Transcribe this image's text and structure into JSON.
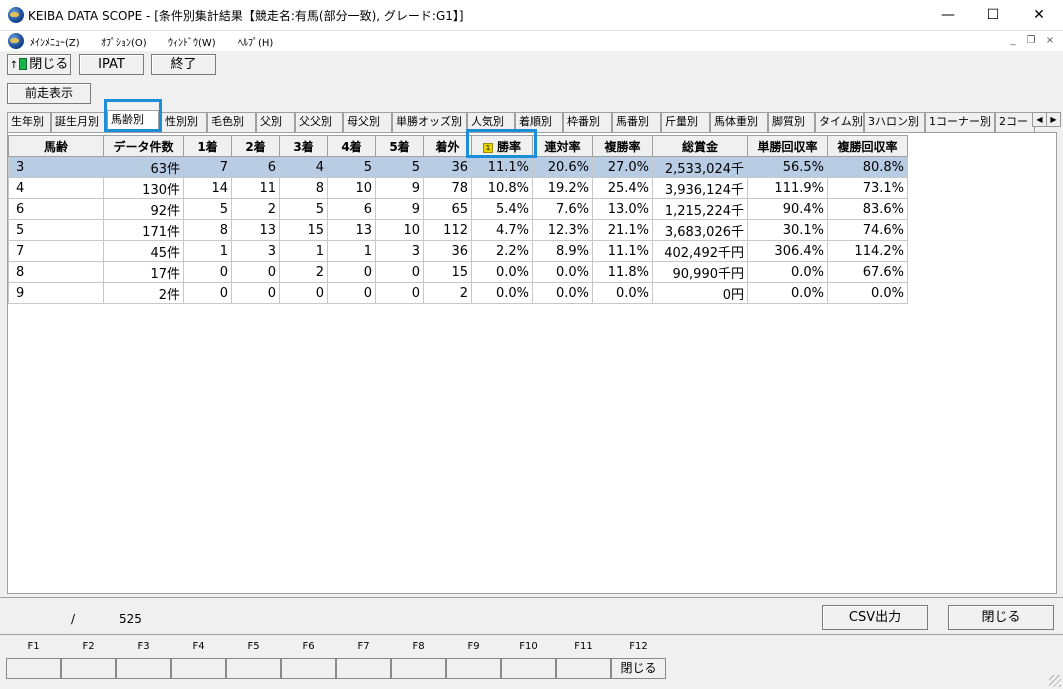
{
  "window": {
    "title": "KEIBA DATA SCOPE - [条件別集計結果【競走名:有馬(部分一致), グレード:G1】]",
    "minimize_glyph": "—",
    "maximize_glyph": "☐",
    "close_glyph": "✕",
    "icon": "app-globe-icon"
  },
  "menubar": {
    "items": [
      "ﾒｲﾝﾒﾆｭｰ(Z)",
      "ｵﾌﾟｼｮﾝ(O)",
      "ｳｨﾝﾄﾞｳ(W)",
      "ﾍﾙﾌﾟ(H)"
    ],
    "mdi_minimize": "_",
    "mdi_restore": "❐",
    "mdi_close": "×"
  },
  "toolbar": {
    "close_label": "閉じる",
    "ipat_label": "IPAT",
    "exit_label": "終了",
    "prev_run_label": "前走表示"
  },
  "tabs": {
    "items": [
      "生年別",
      "誕生月別",
      "馬齢別",
      "性別別",
      "毛色別",
      "父別",
      "父父別",
      "母父別",
      "単勝オッズ別",
      "人気別",
      "着順別",
      "枠番別",
      "馬番別",
      "斤量別",
      "馬体重別",
      "脚質別",
      "タイム別",
      "3ハロン別",
      "1コーナー別",
      "2コー"
    ],
    "active": "馬齢別",
    "scroll_left": "◀",
    "scroll_right": "▶"
  },
  "table": {
    "headers": [
      "馬齢",
      "データ件数",
      "1着",
      "2着",
      "3着",
      "4着",
      "5着",
      "着外",
      "勝率",
      "連対率",
      "複勝率",
      "総賞金",
      "単勝回収率",
      "複勝回収率"
    ],
    "sort_badge": "1",
    "rows": [
      [
        "3",
        "63件",
        "7",
        "6",
        "4",
        "5",
        "5",
        "36",
        "11.1%",
        "20.6%",
        "27.0%",
        "2,533,024千",
        "56.5%",
        "80.8%"
      ],
      [
        "4",
        "130件",
        "14",
        "11",
        "8",
        "10",
        "9",
        "78",
        "10.8%",
        "19.2%",
        "25.4%",
        "3,936,124千",
        "111.9%",
        "73.1%"
      ],
      [
        "6",
        "92件",
        "5",
        "2",
        "5",
        "6",
        "9",
        "65",
        "5.4%",
        "7.6%",
        "13.0%",
        "1,215,224千",
        "90.4%",
        "83.6%"
      ],
      [
        "5",
        "171件",
        "8",
        "13",
        "15",
        "13",
        "10",
        "112",
        "4.7%",
        "12.3%",
        "21.1%",
        "3,683,026千",
        "30.1%",
        "74.6%"
      ],
      [
        "7",
        "45件",
        "1",
        "3",
        "1",
        "1",
        "3",
        "36",
        "2.2%",
        "8.9%",
        "11.1%",
        "402,492千円",
        "306.4%",
        "114.2%"
      ],
      [
        "8",
        "17件",
        "0",
        "0",
        "2",
        "0",
        "0",
        "15",
        "0.0%",
        "0.0%",
        "11.8%",
        "90,990千円",
        "0.0%",
        "67.6%"
      ],
      [
        "9",
        "2件",
        "0",
        "0",
        "0",
        "0",
        "0",
        "2",
        "0.0%",
        "0.0%",
        "0.0%",
        "0円",
        "0.0%",
        "0.0%"
      ]
    ]
  },
  "status": {
    "slash": "/",
    "total": "525",
    "csv_label": "CSV出力",
    "close_label": "閉じる"
  },
  "fkeys": {
    "labels": [
      "F1",
      "F2",
      "F3",
      "F4",
      "F5",
      "F6",
      "F7",
      "F8",
      "F9",
      "F10",
      "F11",
      "F12"
    ],
    "buttons": [
      "",
      "",
      "",
      "",
      "",
      "",
      "",
      "",
      "",
      "",
      "",
      "閉じる"
    ]
  }
}
